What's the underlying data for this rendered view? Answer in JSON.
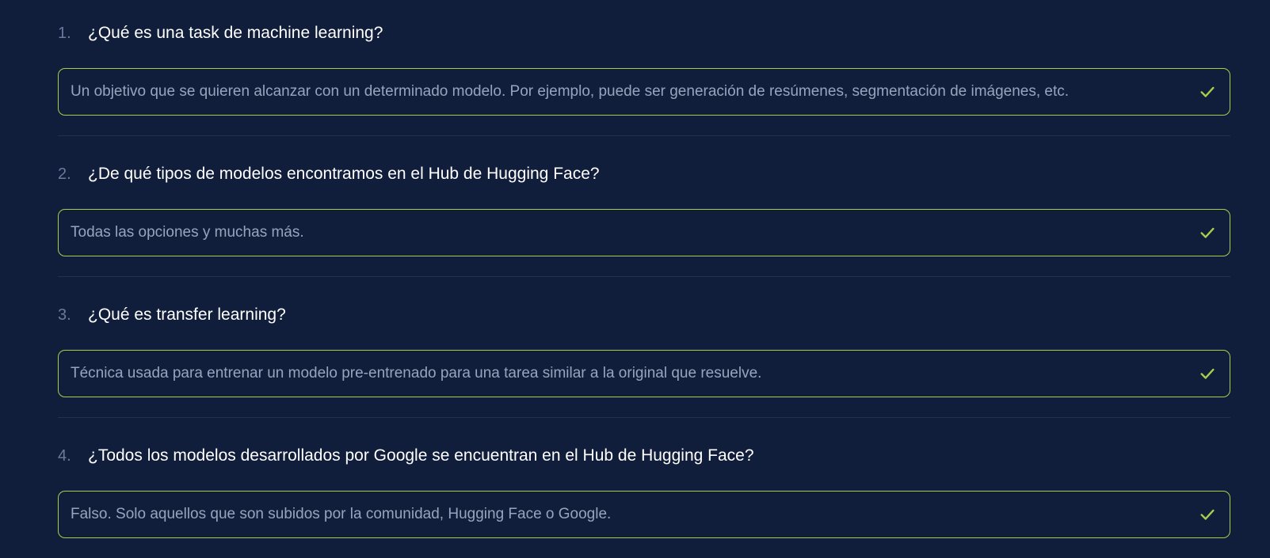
{
  "colors": {
    "background": "#111e3b",
    "answer_border": "#a3d14b",
    "check": "#a3d14b",
    "question_number": "#6b7a9c",
    "question_text": "#ffffff",
    "answer_text": "#98a4be",
    "divider": "#25314c"
  },
  "questions": [
    {
      "number": "1.",
      "title": "¿Qué es una task de machine learning?",
      "answer": "Un objetivo que se quieren alcanzar con un determinado modelo. Por ejemplo, puede ser generación de resúmenes, segmentación de imágenes, etc.",
      "status_icon": "check-icon"
    },
    {
      "number": "2.",
      "title": "¿De qué tipos de modelos encontramos en el Hub de Hugging Face?",
      "answer": "Todas las opciones y muchas más.",
      "status_icon": "check-icon"
    },
    {
      "number": "3.",
      "title": "¿Qué es transfer learning?",
      "answer": "Técnica usada para entrenar un modelo pre-entrenado para una tarea similar a la original que resuelve.",
      "status_icon": "check-icon"
    },
    {
      "number": "4.",
      "title": "¿Todos los modelos desarrollados por Google se encuentran en el Hub de Hugging Face?",
      "answer": "Falso. Solo aquellos que son subidos por la comunidad, Hugging Face o Google.",
      "status_icon": "check-icon"
    }
  ]
}
